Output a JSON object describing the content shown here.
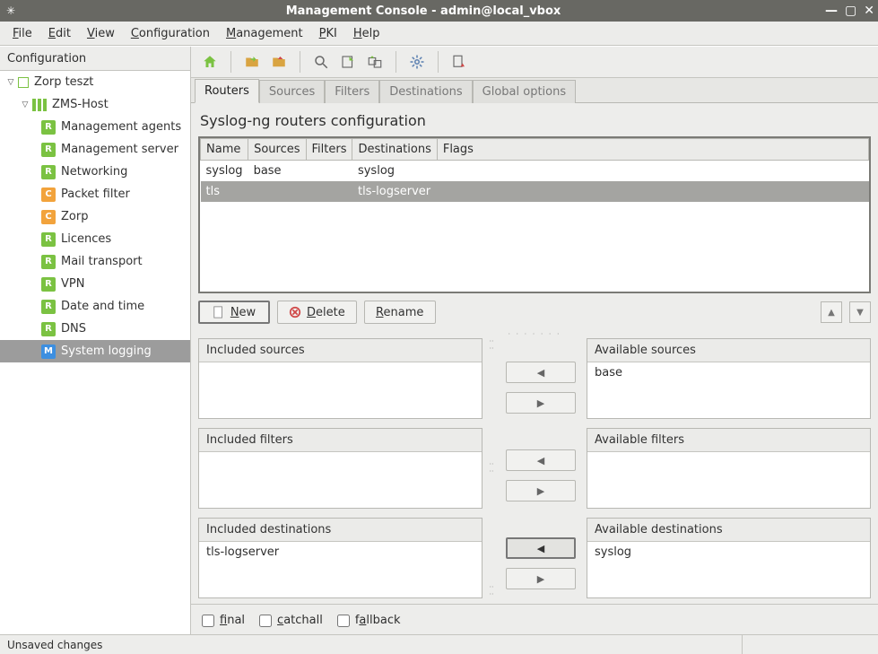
{
  "window": {
    "title": "Management Console - admin@local_vbox"
  },
  "menubar": {
    "file": "File",
    "edit": "Edit",
    "view": "View",
    "configuration": "Configuration",
    "management": "Management",
    "pki": "PKI",
    "help": "Help"
  },
  "sidebar": {
    "header": "Configuration",
    "root": {
      "label": "Zorp teszt"
    },
    "host": {
      "label": "ZMS-Host"
    },
    "items": [
      {
        "label": "Management agents",
        "badge": "R",
        "cls": "ico-green"
      },
      {
        "label": "Management server",
        "badge": "R",
        "cls": "ico-green"
      },
      {
        "label": "Networking",
        "badge": "R",
        "cls": "ico-green"
      },
      {
        "label": "Packet filter",
        "badge": "C",
        "cls": "ico-orange"
      },
      {
        "label": "Zorp",
        "badge": "C",
        "cls": "ico-orange"
      },
      {
        "label": "Licences",
        "badge": "R",
        "cls": "ico-green"
      },
      {
        "label": "Mail transport",
        "badge": "R",
        "cls": "ico-green"
      },
      {
        "label": "VPN",
        "badge": "R",
        "cls": "ico-green"
      },
      {
        "label": "Date and time",
        "badge": "R",
        "cls": "ico-green"
      },
      {
        "label": "DNS",
        "badge": "R",
        "cls": "ico-green"
      },
      {
        "label": "System logging",
        "badge": "M",
        "cls": "ico-blue",
        "selected": true
      }
    ]
  },
  "tabs": {
    "routers": "Routers",
    "sources": "Sources",
    "filters": "Filters",
    "destinations": "Destinations",
    "global": "Global options"
  },
  "section": {
    "title": "Syslog-ng routers configuration"
  },
  "table": {
    "headers": {
      "name": "Name",
      "sources": "Sources",
      "filters": "Filters",
      "destinations": "Destinations",
      "flags": "Flags"
    },
    "rows": [
      {
        "name": "syslog",
        "sources": "base",
        "filters": "",
        "destinations": "syslog",
        "flags": ""
      },
      {
        "name": "tls",
        "sources": "",
        "filters": "",
        "destinations": "tls-logserver",
        "flags": "",
        "selected": true
      }
    ]
  },
  "buttons": {
    "new": "New",
    "delete": "Delete",
    "rename": "Rename"
  },
  "dual": {
    "included_sources": {
      "head": "Included sources"
    },
    "available_sources": {
      "head": "Available sources",
      "items": [
        "base"
      ]
    },
    "included_filters": {
      "head": "Included filters"
    },
    "available_filters": {
      "head": "Available filters"
    },
    "included_destinations": {
      "head": "Included destinations",
      "items": [
        "tls-logserver"
      ]
    },
    "available_destinations": {
      "head": "Available destinations",
      "items": [
        "syslog"
      ]
    }
  },
  "flags": {
    "final": "final",
    "catchall": "catchall",
    "fallback": "fallback"
  },
  "status": {
    "text": "Unsaved changes"
  }
}
